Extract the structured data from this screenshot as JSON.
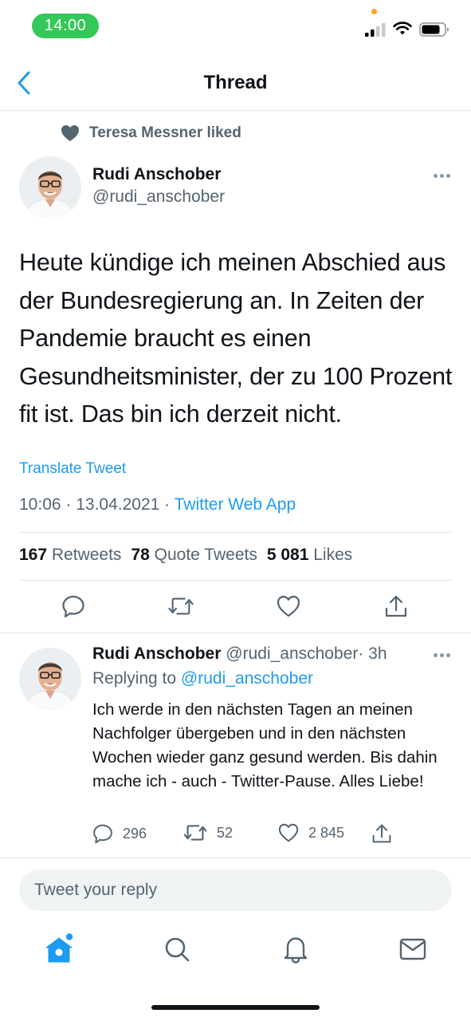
{
  "status_bar": {
    "time": "14:00"
  },
  "header": {
    "title": "Thread"
  },
  "social_context": {
    "text": "Teresa Messner liked"
  },
  "tweet": {
    "author_name": "Rudi Anschober",
    "author_handle": "@rudi_anschober",
    "text": "Heute kündige ich meinen Abschied aus der Bundesregierung an. In Zeiten der Pandemie braucht es einen Gesundheitsminister, der zu 100 Prozent fit ist. Das bin ich derzeit nicht.",
    "translate_label": "Translate Tweet",
    "timestamp": "10:06 · 13.04.2021",
    "separator": " · ",
    "source": "Twitter Web App",
    "stats": {
      "retweets_count": "167",
      "retweets_label": "Retweets",
      "quotes_count": "78",
      "quotes_label": "Quote Tweets",
      "likes_count": "5 081",
      "likes_label": "Likes"
    }
  },
  "reply": {
    "author_name": "Rudi Anschober",
    "author_handle": "@rudi_anschober",
    "age": "· 3h",
    "replying_to_label": "Replying to",
    "replying_to_handle": "@rudi_anschober",
    "text": "Ich werde in den nächsten Tagen an meinen Nachfolger übergeben und in den nächsten Wochen wieder ganz gesund werden. Bis dahin mache ich - auch - Twitter-Pause. Alles Liebe!",
    "reply_count": "296",
    "retweet_count": "52",
    "like_count": "2 845"
  },
  "composer": {
    "placeholder": "Tweet your reply"
  },
  "colors": {
    "accent": "#1d9bf0",
    "status_green": "#34c759",
    "muted_text": "#536471"
  },
  "tabs": [
    "home-icon",
    "search-icon",
    "notifications-icon",
    "messages-icon"
  ]
}
